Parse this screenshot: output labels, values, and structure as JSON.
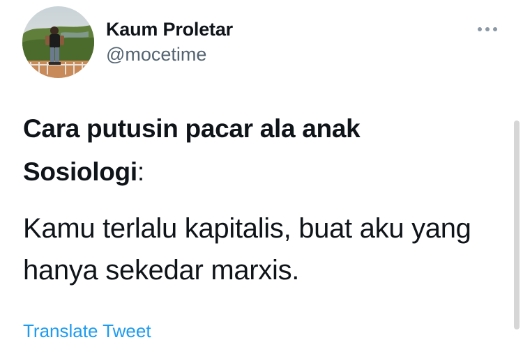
{
  "author": {
    "display_name": "Kaum Proletar",
    "handle": "@mocetime",
    "avatar_icon": "profile-photo"
  },
  "more_icon": "more-horizontal-icon",
  "tweet": {
    "line1": "Cara putusin pacar ala anak",
    "line2": "Sosiologi",
    "line2_suffix": ":",
    "line3": "Kamu terlalu kapitalis, buat aku yang",
    "line4": "hanya sekedar marxis."
  },
  "translate_label": "Translate Tweet",
  "colors": {
    "text": "#0f1419",
    "secondary": "#536471",
    "link": "#1d9bf0"
  }
}
